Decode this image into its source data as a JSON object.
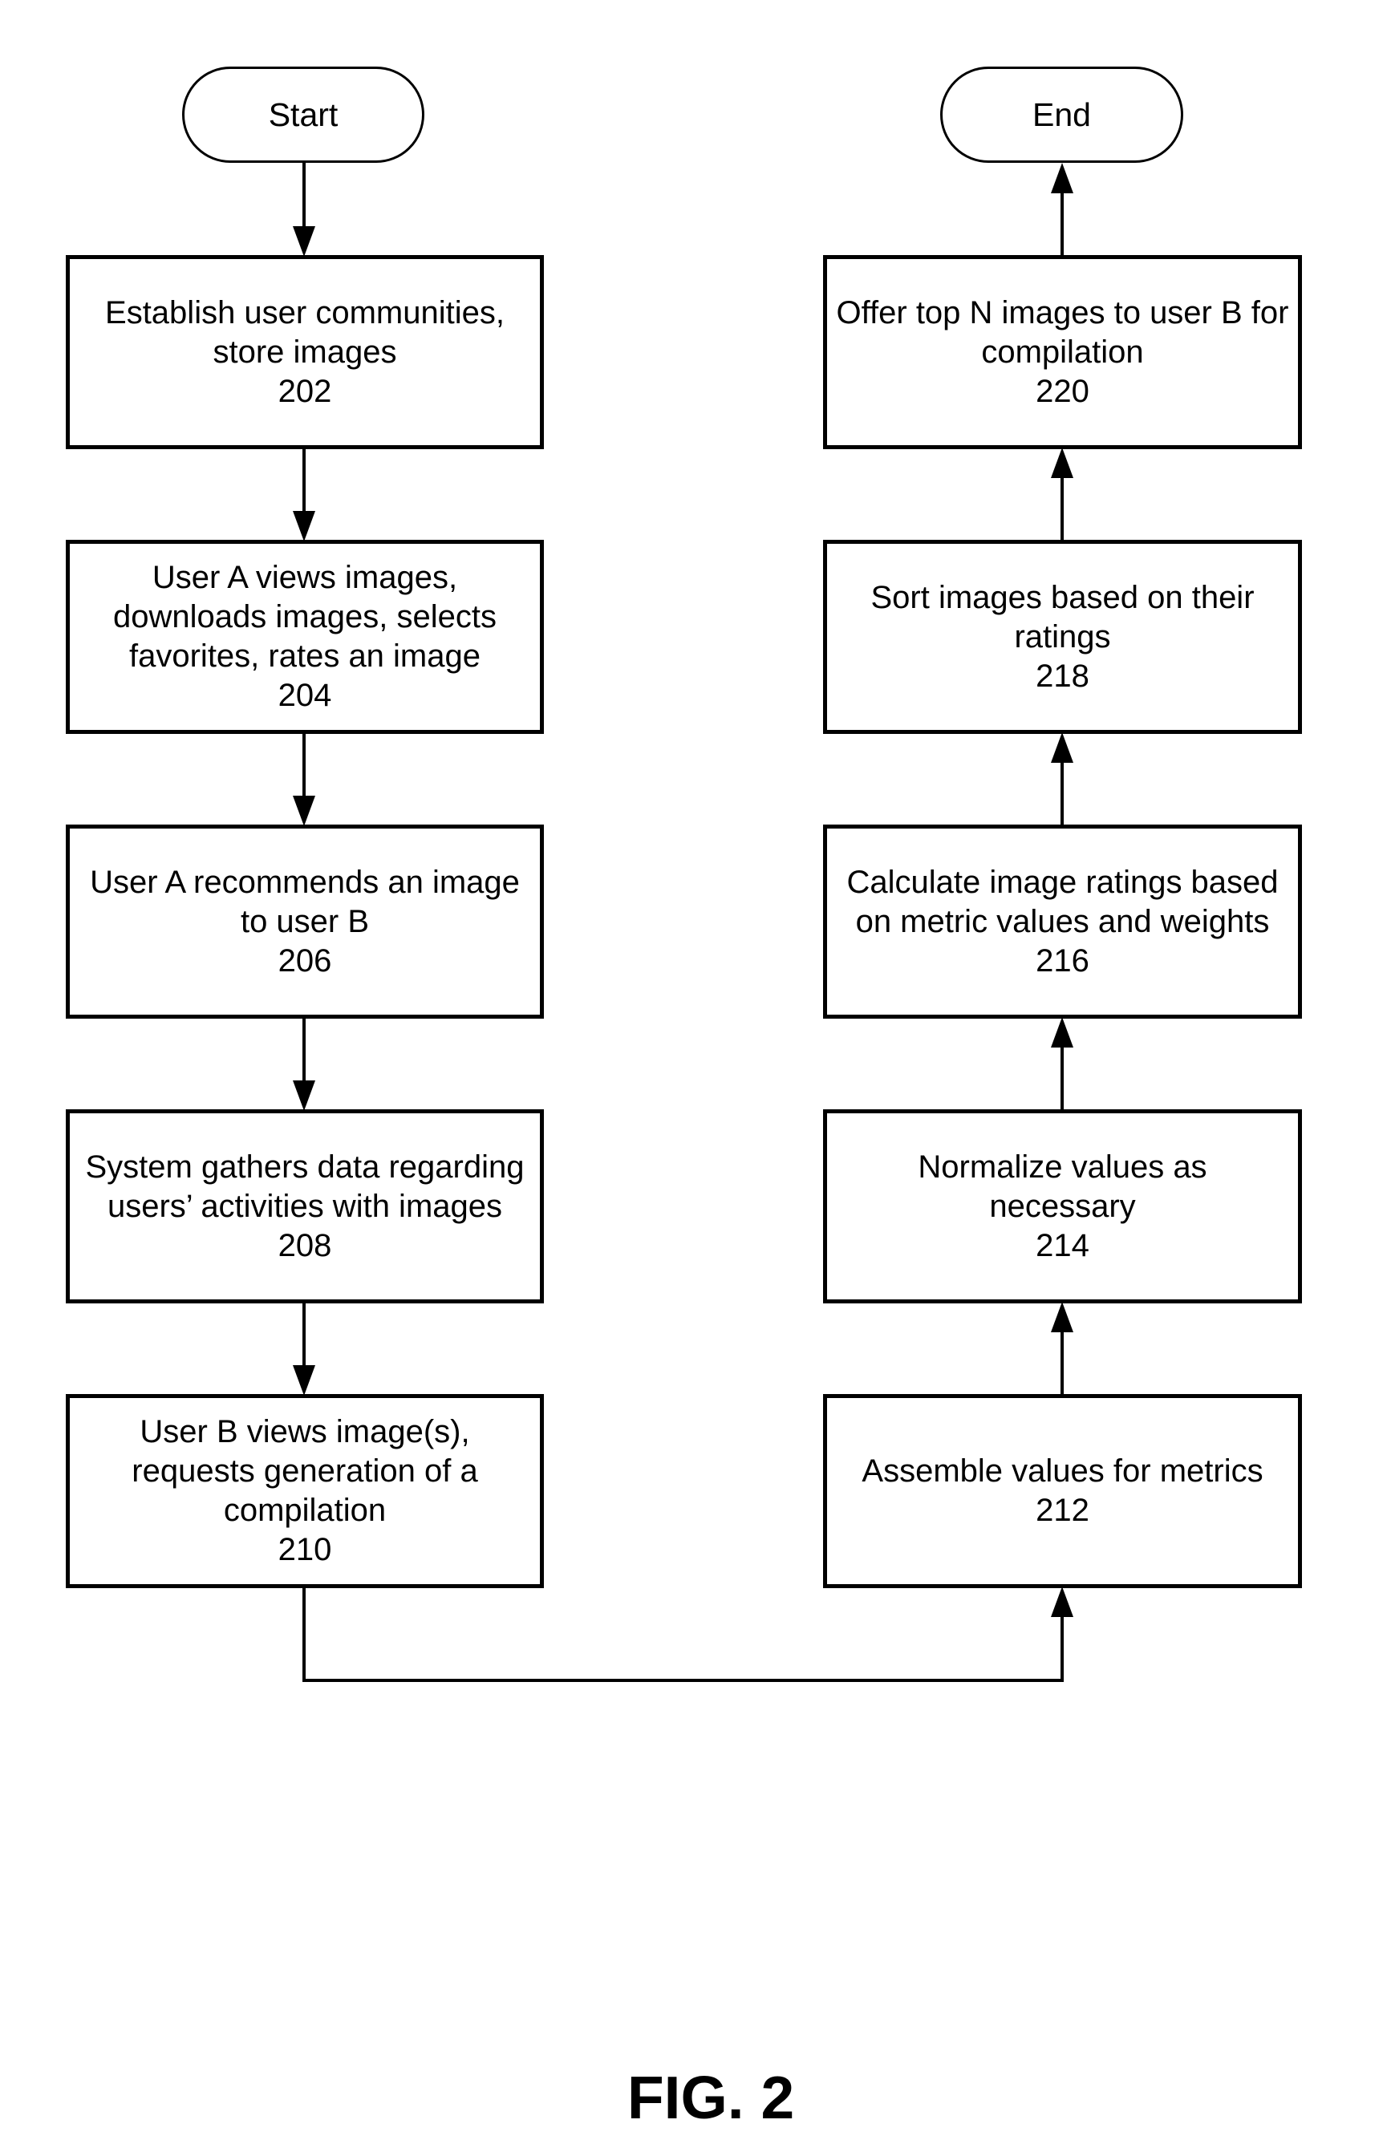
{
  "figure": {
    "label": "FIG. 2",
    "type": "flowchart"
  },
  "terminals": {
    "start": "Start",
    "end": "End"
  },
  "steps": [
    {
      "id": "202",
      "text": "Establish user communities, store images",
      "column": "left"
    },
    {
      "id": "204",
      "text": "User A views images, downloads images, selects favorites, rates an image",
      "column": "left"
    },
    {
      "id": "206",
      "text": "User A recommends an image to user B",
      "column": "left"
    },
    {
      "id": "208",
      "text": "System gathers data regarding users’ activities with images",
      "column": "left"
    },
    {
      "id": "210",
      "text": "User B views image(s), requests generation of a compilation",
      "column": "left"
    },
    {
      "id": "212",
      "text": "Assemble values for metrics",
      "column": "right"
    },
    {
      "id": "214",
      "text": "Normalize values as necessary",
      "column": "right"
    },
    {
      "id": "216",
      "text": "Calculate image ratings based on metric values and weights",
      "column": "right"
    },
    {
      "id": "218",
      "text": "Sort images based on their ratings",
      "column": "right"
    },
    {
      "id": "220",
      "text": "Offer top N images to user B for compilation",
      "column": "right"
    }
  ],
  "flow": [
    "Start",
    "202",
    "204",
    "206",
    "208",
    "210",
    "212",
    "214",
    "216",
    "218",
    "220",
    "End"
  ]
}
